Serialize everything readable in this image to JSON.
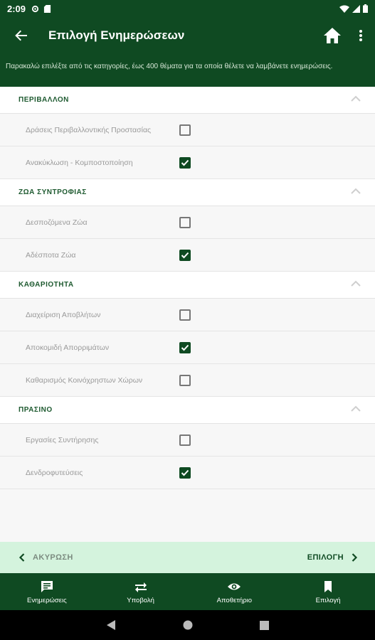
{
  "status_bar": {
    "time": "2:09"
  },
  "app_bar": {
    "title": "Επιλογή Ενημερώσεων"
  },
  "info_text": "Παρακαλώ επιλέξτε από τις κατηγορίες, έως 400 θέματα για τα οποία θέλετε να λαμβάνετε ενημερώσεις.",
  "sections": [
    {
      "title": "ΠΕΡΙΒΑΛΛΟΝ",
      "items": [
        {
          "label": "Δράσεις Περιβαλλοντικής Προστασίας",
          "checked": false
        },
        {
          "label": "Ανακύκλωση - Κομποστοποίηση",
          "checked": true
        }
      ]
    },
    {
      "title": "ΖΩΑ ΣΥΝΤΡΟΦΙΑΣ",
      "items": [
        {
          "label": "Δεσποζόμενα Ζώα",
          "checked": false
        },
        {
          "label": "Αδέσποτα Ζώα",
          "checked": true
        }
      ]
    },
    {
      "title": "ΚΑΘΑΡΙΟΤΗΤΑ",
      "items": [
        {
          "label": "Διαχείριση Αποβλήτων",
          "checked": false
        },
        {
          "label": "Αποκομιδή Απορριμάτων",
          "checked": true
        },
        {
          "label": "Καθαρισμός Κοινόχρηστων Χώρων",
          "checked": false
        }
      ]
    },
    {
      "title": "ΠΡΑΣΙΝΟ",
      "items": [
        {
          "label": "Εργασίες Συντήρησης",
          "checked": false
        },
        {
          "label": "Δενδροφυτεύσεις",
          "checked": true
        }
      ]
    }
  ],
  "actions": {
    "cancel": "ΑΚΥΡΩΣΗ",
    "select": "ΕΠΙΛΟΓΗ"
  },
  "bottom_nav": [
    {
      "label": "Ενημερώσεις",
      "icon": "chat-icon"
    },
    {
      "label": "Υποβολή",
      "icon": "swap-icon"
    },
    {
      "label": "Αποθετήριο",
      "icon": "eye-icon"
    },
    {
      "label": "Επιλογή",
      "icon": "bookmark-icon"
    }
  ],
  "colors": {
    "primary": "#0f4a22",
    "action_bar": "#d4f3dd"
  }
}
